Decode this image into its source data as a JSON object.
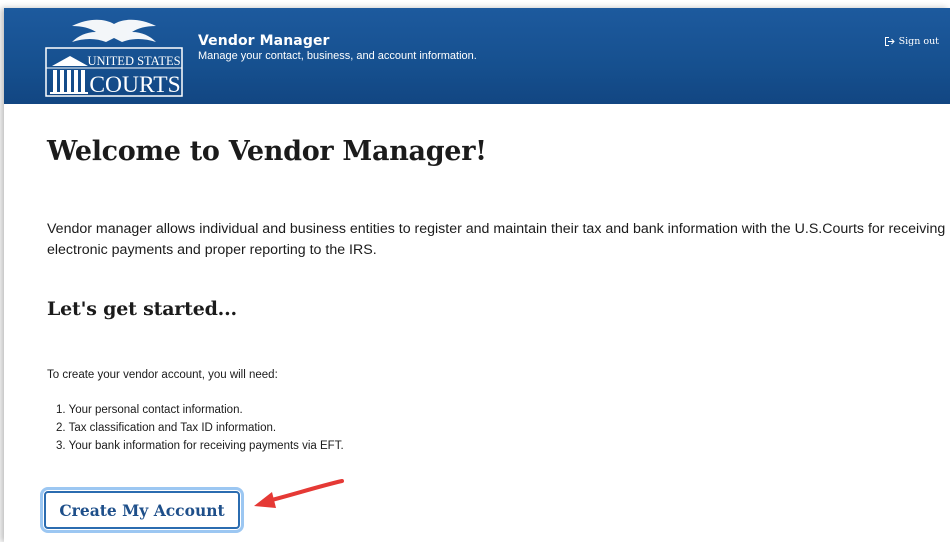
{
  "header": {
    "logo_line1": "UNITED STATES",
    "logo_line2": "COURTS",
    "app_title": "Vendor Manager",
    "app_subtitle": "Manage your contact, business, and account information.",
    "signout_label": "Sign out",
    "signout_icon": "sign-out-icon"
  },
  "main": {
    "title": "Welcome to Vendor Manager!",
    "intro": "Vendor manager allows individual and business entities to register and maintain their tax and bank information with the U.S.Courts for receiving electronic payments and proper reporting to the IRS.",
    "subtitle": "Let's get started...",
    "need_text": "To create your vendor account, you will need:",
    "steps": [
      "1. Your personal contact information.",
      "2. Tax classification and Tax ID information.",
      "3. Your bank information for receiving payments via EFT."
    ],
    "cta_label": "Create My Account"
  },
  "colors": {
    "header_bg": "#16508f",
    "cta_border": "#2b6cb0",
    "cta_text": "#1e4f8a",
    "annotation_arrow": "#e53935"
  }
}
